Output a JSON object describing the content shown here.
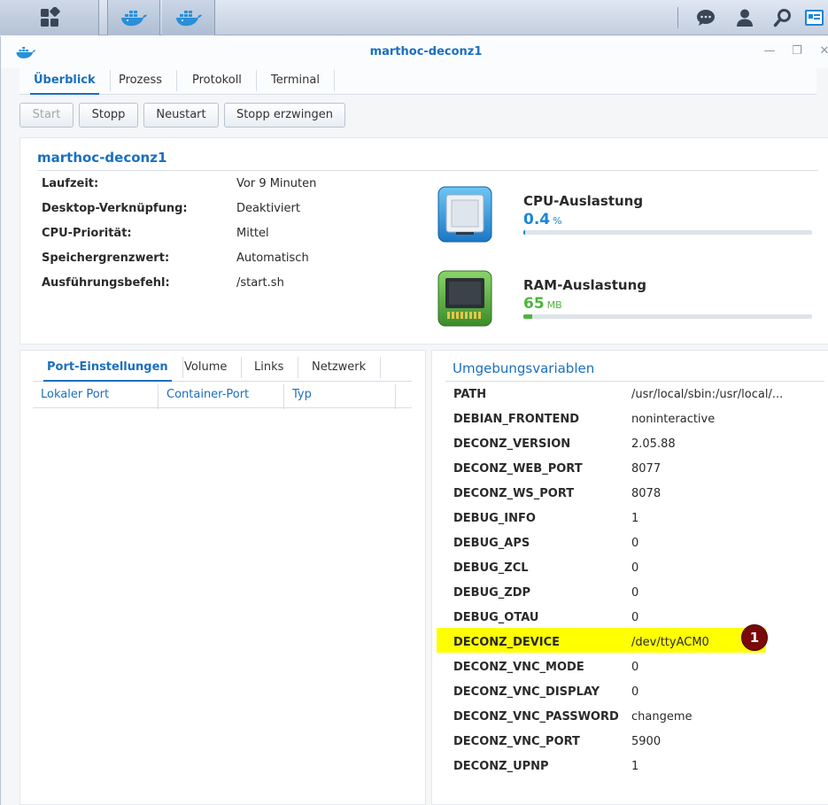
{
  "taskbar": {
    "icons": [
      "grid-icon",
      "docker-icon",
      "docker-icon",
      "chat-icon",
      "user-icon",
      "search-icon",
      "widgets-icon"
    ]
  },
  "window": {
    "title": "marthoc-deconz1",
    "tabs": [
      {
        "label": "Überblick",
        "active": true
      },
      {
        "label": "Prozess",
        "active": false
      },
      {
        "label": "Protokoll",
        "active": false
      },
      {
        "label": "Terminal",
        "active": false
      }
    ]
  },
  "toolbar": {
    "start_label": "Start",
    "stop_label": "Stopp",
    "restart_label": "Neustart",
    "force_stop_label": "Stopp erzwingen"
  },
  "overview": {
    "container_name": "marthoc-deconz1",
    "rows": [
      {
        "label": "Laufzeit:",
        "value": "Vor 9 Minuten"
      },
      {
        "label": "Desktop-Verknüpfung:",
        "value": "Deaktiviert"
      },
      {
        "label": "CPU-Priorität:",
        "value": "Mittel"
      },
      {
        "label": "Speichergrenzwert:",
        "value": "Automatisch"
      },
      {
        "label": "Ausführungsbefehl:",
        "value": "/start.sh"
      }
    ],
    "cpu": {
      "title": "CPU-Auslastung",
      "value": "0.4",
      "unit": "%",
      "fraction": 0.004,
      "color": "#1a86d8"
    },
    "ram": {
      "title": "RAM-Auslastung",
      "value": "65",
      "unit": "MB",
      "fraction": 0.03,
      "color": "#4db53c"
    }
  },
  "ports": {
    "tabs": [
      {
        "label": "Port-Einstellungen",
        "active": true
      },
      {
        "label": "Volume",
        "active": false
      },
      {
        "label": "Links",
        "active": false
      },
      {
        "label": "Netzwerk",
        "active": false
      }
    ],
    "columns": [
      "Lokaler Port",
      "Container-Port",
      "Typ"
    ]
  },
  "env": {
    "title": "Umgebungsvariablen",
    "rows": [
      {
        "key": "PATH",
        "value": "/usr/local/sbin:/usr/local/..."
      },
      {
        "key": "DEBIAN_FRONTEND",
        "value": "noninteractive"
      },
      {
        "key": "DECONZ_VERSION",
        "value": "2.05.88"
      },
      {
        "key": "DECONZ_WEB_PORT",
        "value": "8077"
      },
      {
        "key": "DECONZ_WS_PORT",
        "value": "8078"
      },
      {
        "key": "DEBUG_INFO",
        "value": "1"
      },
      {
        "key": "DEBUG_APS",
        "value": "0"
      },
      {
        "key": "DEBUG_ZCL",
        "value": "0"
      },
      {
        "key": "DEBUG_ZDP",
        "value": "0"
      },
      {
        "key": "DEBUG_OTAU",
        "value": "0"
      },
      {
        "key": "DECONZ_DEVICE",
        "value": "/dev/ttyACM0"
      },
      {
        "key": "DECONZ_VNC_MODE",
        "value": "0"
      },
      {
        "key": "DECONZ_VNC_DISPLAY",
        "value": "0"
      },
      {
        "key": "DECONZ_VNC_PASSWORD",
        "value": "changeme"
      },
      {
        "key": "DECONZ_VNC_PORT",
        "value": "5900"
      },
      {
        "key": "DECONZ_UPNP",
        "value": "1"
      }
    ],
    "highlight_color": "#ffff00",
    "badge_label": "1"
  }
}
